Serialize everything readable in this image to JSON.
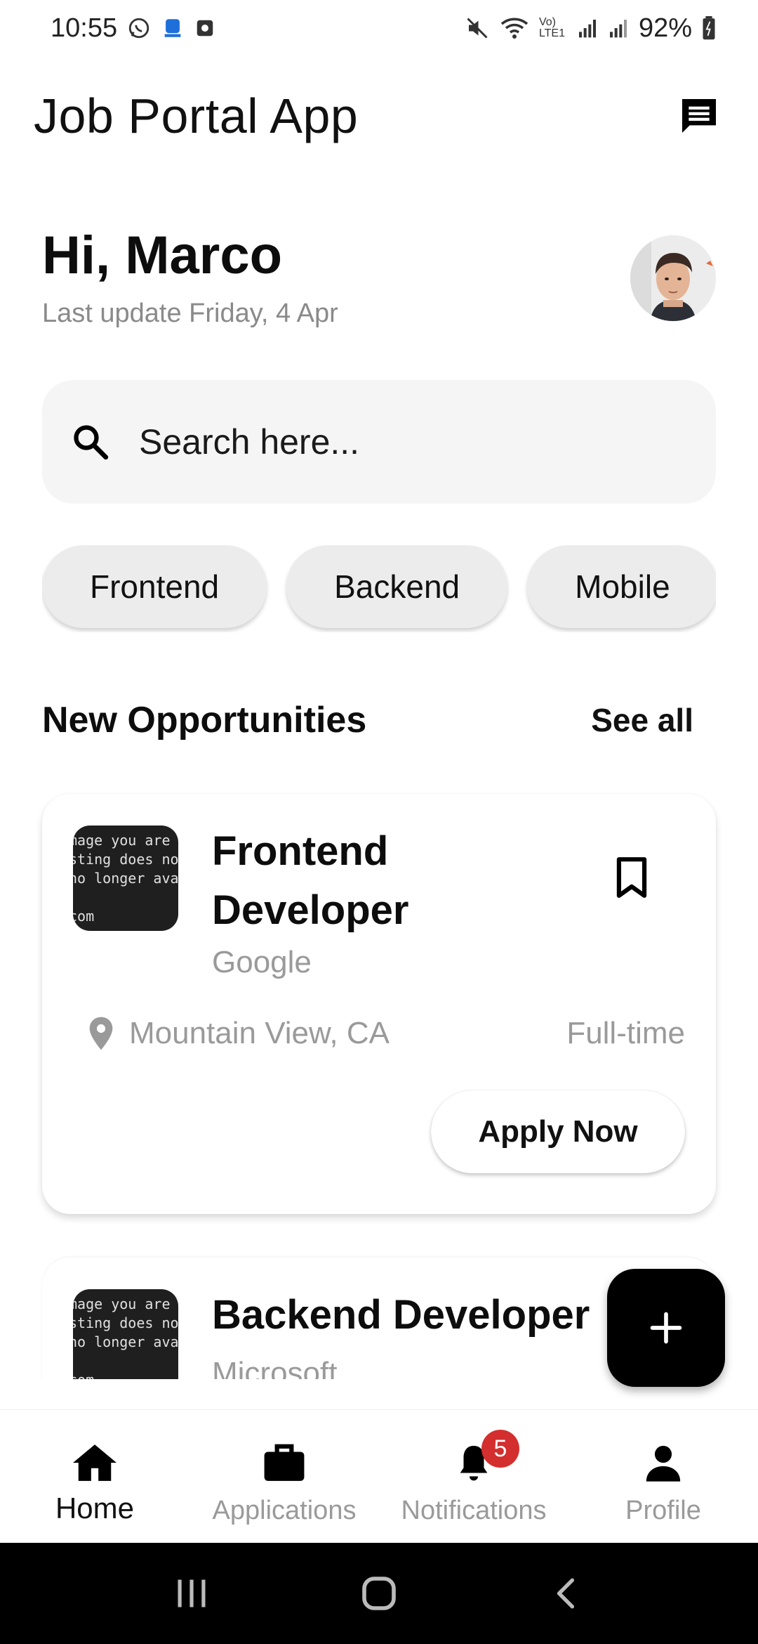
{
  "status_bar": {
    "time": "10:55",
    "network_label": "Vo) LTE1",
    "battery": "92%"
  },
  "app_bar": {
    "title": "Job Portal App",
    "chat_icon": "chat-icon"
  },
  "greeting": {
    "title": "Hi, Marco",
    "subtitle": "Last update Friday, 4 Apr"
  },
  "search": {
    "placeholder": "Search here..."
  },
  "categories": [
    "Frontend",
    "Backend",
    "Mobile"
  ],
  "section": {
    "title": "New Opportunities",
    "see_all": "See all"
  },
  "logo_placeholder_lines": [
    "mage you are",
    "sting does not",
    "no longer avail",
    "",
    "com"
  ],
  "jobs": [
    {
      "title": "Frontend Developer",
      "company": "Google",
      "location": "Mountain View, CA",
      "type": "Full-time",
      "apply_label": "Apply Now"
    },
    {
      "title": "Backend Developer",
      "company": "Microsoft"
    }
  ],
  "bottom_nav": [
    {
      "label": "Home",
      "icon": "home-icon",
      "active": true
    },
    {
      "label": "Applications",
      "icon": "briefcase-icon"
    },
    {
      "label": "Notifications",
      "icon": "bell-icon",
      "badge": "5"
    },
    {
      "label": "Profile",
      "icon": "person-icon"
    }
  ],
  "colors": {
    "primary": "#000000",
    "muted_text": "#9a9a9a",
    "chip_bg": "#ececec",
    "search_bg": "#f5f5f5",
    "badge": "#d32f2f"
  }
}
